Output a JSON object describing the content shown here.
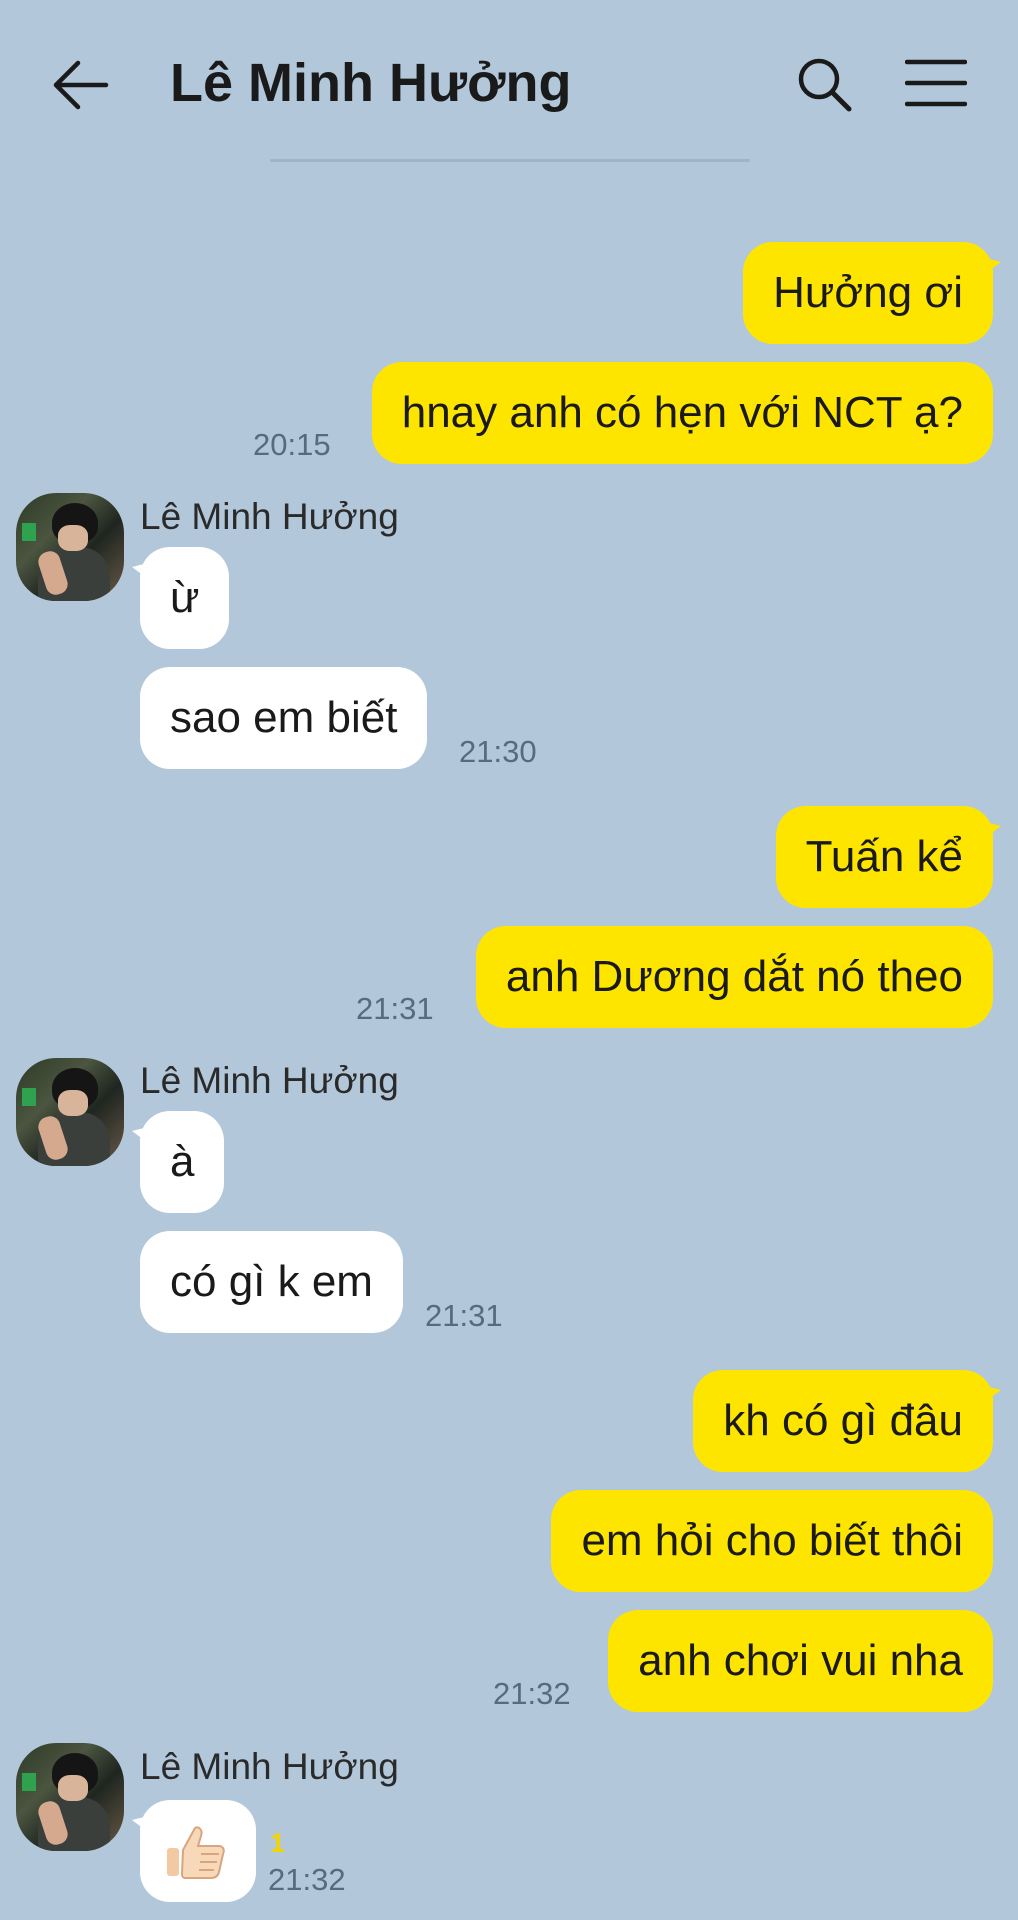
{
  "header": {
    "title": "Lê Minh Hưởng"
  },
  "icons": {
    "back": "arrow-left-icon",
    "search": "search-icon",
    "menu": "hamburger-menu-icon"
  },
  "colors": {
    "background": "#b2c7da",
    "my_bubble": "#fee500",
    "their_bubble": "#ffffff"
  },
  "messages": {
    "m1": "Hưởng ơi",
    "m2": "hnay anh có hẹn với NCT ạ?",
    "t1": "20:15",
    "sender1": "Lê Minh Hưởng",
    "r1": "ừ",
    "r2": "sao em biết",
    "t2": "21:30",
    "m3": "Tuấn kể",
    "m4": "anh Dương dắt nó theo",
    "t3": "21:31",
    "sender2": "Lê Minh Hưởng",
    "r3": "à",
    "r4": "có gì k em",
    "t4": "21:31",
    "m5": "kh có gì đâu",
    "m6": "em hỏi cho biết thôi",
    "m7": "anh chơi vui nha",
    "t5": "21:32",
    "sender3": "Lê Minh Hưởng",
    "r5_emoji": "thumbs-up-emoji",
    "unread": "1",
    "t6": "21:32"
  }
}
